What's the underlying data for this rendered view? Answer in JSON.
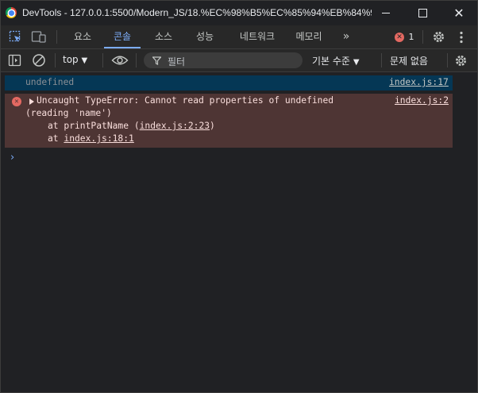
{
  "window": {
    "title": "DevTools - 127.0.0.1:5500/Modern_JS/18.%EC%98%B5%EC%85%94%EB%84%9..."
  },
  "tabs": [
    {
      "label": "요소",
      "active": false
    },
    {
      "label": "콘솔",
      "active": true
    },
    {
      "label": "소스",
      "active": false
    },
    {
      "label": "성능",
      "active": false
    },
    {
      "label": "네트워크",
      "active": false
    },
    {
      "label": "메모리",
      "active": false
    }
  ],
  "tabbar": {
    "more": "»",
    "error_count": "1"
  },
  "toolbar": {
    "context": "top",
    "filter_placeholder": "필터",
    "levels": "기본 수준",
    "issues": "문제 없음"
  },
  "console": {
    "log": {
      "text": "undefined",
      "source": "index.js:17"
    },
    "error": {
      "line1": "Uncaught TypeError: Cannot read properties of undefined",
      "line2": "(reading 'name')",
      "frame1_prefix": "at printPatName (",
      "frame1_link": "index.js:2:23",
      "frame1_suffix": ")",
      "frame2_prefix": "at ",
      "frame2_link": "index.js:18:1",
      "source": "index.js:2"
    },
    "prompt": "›"
  },
  "colors": {
    "accent": "#7cacf8",
    "error_bg": "#4e3534",
    "log_bg": "#053755",
    "error_icon": "#e46962"
  }
}
